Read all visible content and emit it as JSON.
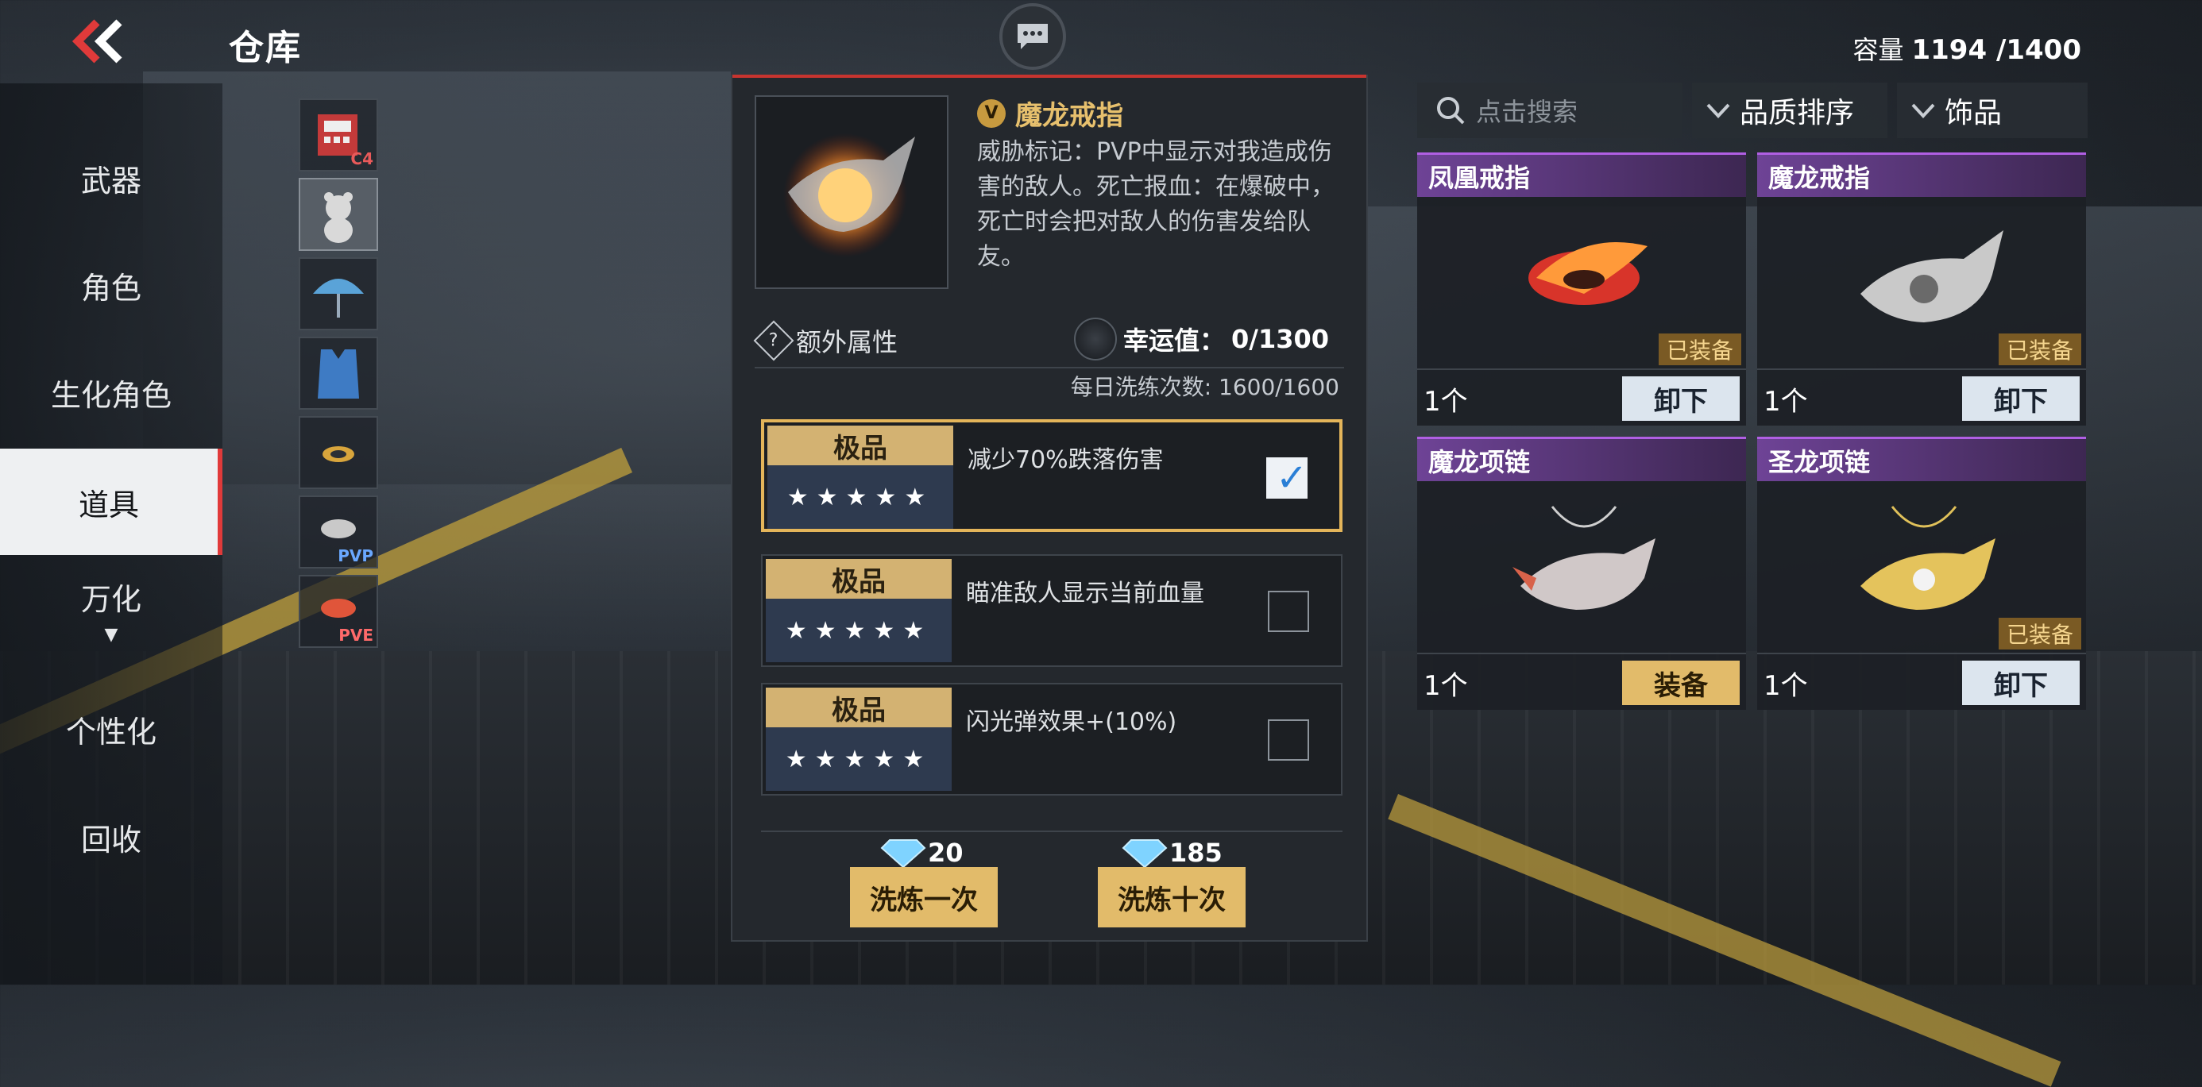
{
  "header": {
    "title": "仓库",
    "capacity_label": "容量",
    "capacity_value": "1194 /1400"
  },
  "nav": {
    "items": [
      {
        "label": "武器"
      },
      {
        "label": "角色"
      },
      {
        "label": "生化角色"
      },
      {
        "label": "道具",
        "active": true
      },
      {
        "label": "万化"
      },
      {
        "label": "个性化"
      },
      {
        "label": "回收"
      }
    ]
  },
  "categories": {
    "items": [
      {
        "name": "c4-icon",
        "tag": "C4"
      },
      {
        "name": "bear-icon",
        "tag": ""
      },
      {
        "name": "umbrella-icon",
        "tag": ""
      },
      {
        "name": "vest-icon",
        "tag": ""
      },
      {
        "name": "ring-icon",
        "tag": ""
      },
      {
        "name": "pvp-ring-icon",
        "tag": "PVP"
      },
      {
        "name": "pve-ring-icon",
        "tag": "PVE"
      }
    ]
  },
  "detail": {
    "name": "魔龙戒指",
    "vip_badge": "V",
    "description": "威胁标记：PVP中显示对我造成伤害的敌人。死亡报血：在爆破中，死亡时会把对敌人的伤害发给队友。",
    "extra_attr_label": "额外属性",
    "luck_label": "幸运值：",
    "luck_value": "0/1300",
    "daily_label": "每日洗练次数: ",
    "daily_value": "1600/1600",
    "attributes": [
      {
        "grade": "极品",
        "stars": "★★★★★",
        "text": "减少70%跌落伤害",
        "checked": true
      },
      {
        "grade": "极品",
        "stars": "★★★★★",
        "text": "瞄准敌人显示当前血量",
        "checked": false
      },
      {
        "grade": "极品",
        "stars": "★★★★★",
        "text": "闪光弹效果+(10%)",
        "checked": false
      }
    ],
    "refine_once": {
      "cost": "20",
      "label": "洗炼一次"
    },
    "refine_ten": {
      "cost": "185",
      "label": "洗炼十次"
    }
  },
  "inventory": {
    "search_placeholder": "点击搜索",
    "sort_label": "品质排序",
    "filter_label": "饰品",
    "equipped_label": "已装备",
    "cards": [
      {
        "title": "凤凰戒指",
        "qty": "1个",
        "equipped": true,
        "button": "卸下",
        "icon": "phoenix-ring-icon"
      },
      {
        "title": "魔龙戒指",
        "qty": "1个",
        "equipped": true,
        "button": "卸下",
        "icon": "dragon-ring-icon"
      },
      {
        "title": "魔龙项链",
        "qty": "1个",
        "equipped": false,
        "button": "装备",
        "icon": "dragon-necklace-icon"
      },
      {
        "title": "圣龙项链",
        "qty": "1个",
        "equipped": true,
        "button": "卸下",
        "icon": "holy-dragon-necklace-icon"
      }
    ]
  },
  "colors": {
    "accent_gold": "#e2bb6a",
    "item_name": "#e7c06d",
    "card_header_purple": "#6e4396",
    "active_nav_marker": "#e03a3a"
  }
}
